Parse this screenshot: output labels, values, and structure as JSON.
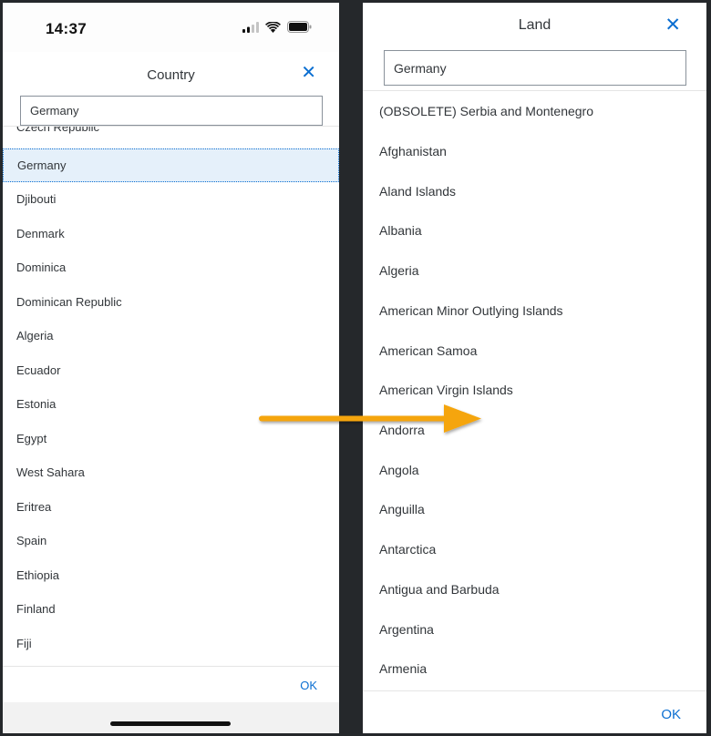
{
  "left": {
    "status": {
      "time": "14:37"
    },
    "dialog_title": "Country",
    "search_value": "Germany",
    "partial_item": "Czech Republic",
    "items": [
      {
        "label": "Germany",
        "selected": true
      },
      {
        "label": "Djibouti"
      },
      {
        "label": "Denmark"
      },
      {
        "label": "Dominica"
      },
      {
        "label": "Dominican Republic"
      },
      {
        "label": "Algeria"
      },
      {
        "label": "Ecuador"
      },
      {
        "label": "Estonia"
      },
      {
        "label": "Egypt"
      },
      {
        "label": "West Sahara"
      },
      {
        "label": "Eritrea"
      },
      {
        "label": "Spain"
      },
      {
        "label": "Ethiopia"
      },
      {
        "label": "Finland"
      },
      {
        "label": "Fiji"
      }
    ],
    "ok_label": "OK"
  },
  "right": {
    "dialog_title": "Land",
    "search_value": "Germany",
    "items": [
      {
        "label": "(OBSOLETE) Serbia and Montenegro"
      },
      {
        "label": "Afghanistan"
      },
      {
        "label": "Aland Islands"
      },
      {
        "label": "Albania"
      },
      {
        "label": "Algeria"
      },
      {
        "label": "American Minor Outlying Islands"
      },
      {
        "label": "American Samoa"
      },
      {
        "label": "American Virgin Islands"
      },
      {
        "label": "Andorra"
      },
      {
        "label": "Angola"
      },
      {
        "label": "Anguilla"
      },
      {
        "label": "Antarctica"
      },
      {
        "label": "Antigua and Barbuda"
      },
      {
        "label": "Argentina"
      },
      {
        "label": "Armenia"
      }
    ],
    "ok_label": "OK"
  },
  "icons": {
    "close": "close-icon",
    "signal": "cellular-signal-icon",
    "wifi": "wifi-icon",
    "battery": "battery-icon",
    "arrow": "arrow-right-icon"
  },
  "colors": {
    "accent": "#0a6ed1",
    "selected_bg": "#e5f0fa",
    "arrow": "#f5a50a",
    "background": "#25282b"
  }
}
